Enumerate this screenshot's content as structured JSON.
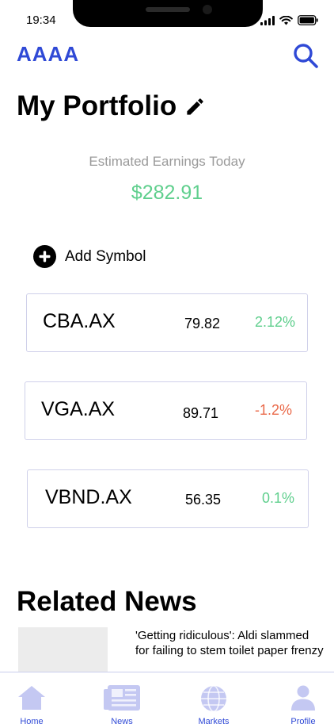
{
  "status_bar": {
    "time": "19:34"
  },
  "header": {
    "logo": "AAAA",
    "search_icon": "search-icon"
  },
  "page": {
    "title": "My Portfolio",
    "edit_icon": "pencil-icon"
  },
  "earnings": {
    "label": "Estimated Earnings Today",
    "value": "$282.91"
  },
  "add_symbol": {
    "label": "Add Symbol",
    "icon": "plus-circle-icon"
  },
  "stocks": [
    {
      "symbol": "CBA.AX",
      "price": "79.82",
      "change": "2.12%",
      "direction": "up"
    },
    {
      "symbol": "VGA.AX",
      "price": "89.71",
      "change": "-1.2%",
      "direction": "down"
    },
    {
      "symbol": "VBND.AX",
      "price": "56.35",
      "change": "0.1%",
      "direction": "up"
    }
  ],
  "news": {
    "heading": "Related News",
    "items": [
      {
        "headline": "'Getting ridiculous': Aldi slammed for failing to stem toilet paper frenzy"
      }
    ]
  },
  "tabs": [
    {
      "label": "Home",
      "icon": "home-icon"
    },
    {
      "label": "News",
      "icon": "newspaper-icon"
    },
    {
      "label": "Markets",
      "icon": "globe-icon"
    },
    {
      "label": "Profile",
      "icon": "person-icon"
    }
  ],
  "colors": {
    "accent": "#2f49d6",
    "positive": "#5fcf8d",
    "negative": "#ea6a4a",
    "tab_icon": "#c4c8f2"
  }
}
